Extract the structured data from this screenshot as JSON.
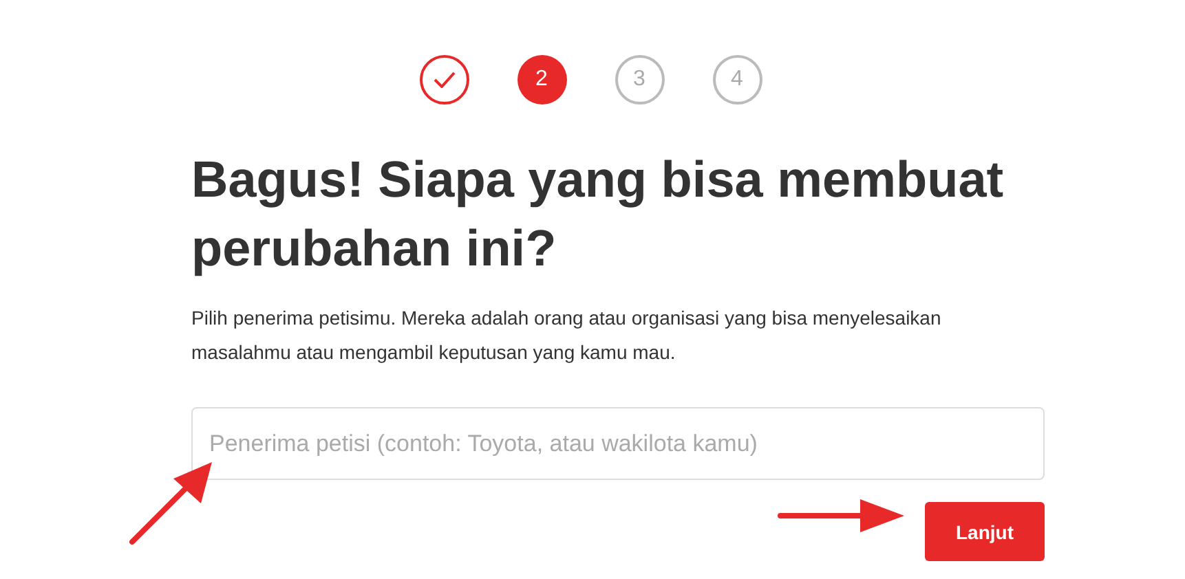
{
  "steps": [
    {
      "kind": "done"
    },
    {
      "label": "2",
      "kind": "current"
    },
    {
      "label": "3",
      "kind": "upcoming"
    },
    {
      "label": "4",
      "kind": "upcoming"
    }
  ],
  "title": "Bagus! Siapa yang bisa membuat perubahan ini?",
  "description": "Pilih penerima petisimu. Mereka adalah orang atau organisasi yang bisa menyelesaikan masalahmu atau mengambil keputusan yang kamu mau.",
  "recipient_field": {
    "placeholder": "Penerima petisi (contoh: Toyota, atau wakilota kamu)"
  },
  "next_button": "Lanjut"
}
